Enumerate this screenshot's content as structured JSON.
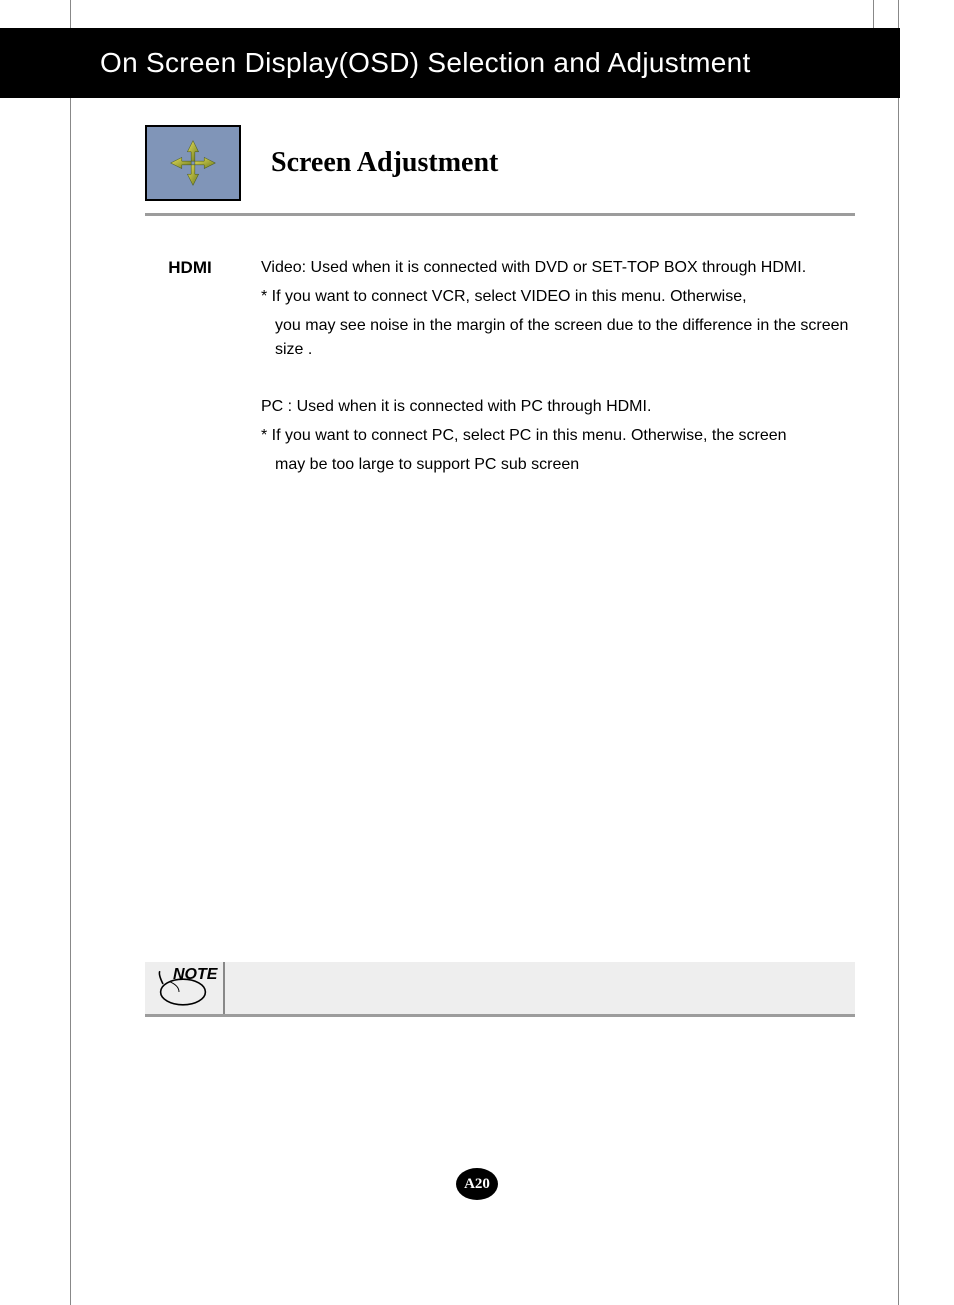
{
  "header": {
    "title": "On Screen Display(OSD) Selection and Adjustment"
  },
  "section": {
    "title": "Screen Adjustment"
  },
  "hdmi": {
    "label": "HDMI",
    "video_line": "Video: Used when it is connected with DVD or SET-TOP BOX through HDMI.",
    "video_note_1": "* If you want to connect VCR, select VIDEO in this menu. Otherwise,",
    "video_note_2": "you may see noise in the margin of the screen due to the difference in the screen size .",
    "pc_line": "PC : Used when it is connected with PC through HDMI.",
    "pc_note_1": "* If you want to connect PC, select PC in this menu. Otherwise, the screen",
    "pc_note_2": "may be too large to support PC sub screen"
  },
  "note": {
    "label": "NOTE"
  },
  "page": {
    "number": "A20"
  }
}
